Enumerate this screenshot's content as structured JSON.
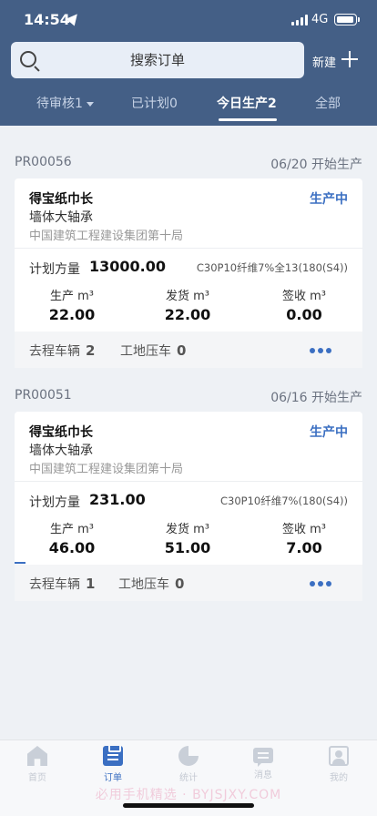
{
  "status_bar": {
    "time": "14:54",
    "network": "4G"
  },
  "search": {
    "placeholder": "搜索订单"
  },
  "header": {
    "new_label": "新建"
  },
  "tabs": [
    {
      "label": "待审核1",
      "active": false,
      "has_dropdown": true
    },
    {
      "label": "已计划0",
      "active": false
    },
    {
      "label": "今日生产2",
      "active": true
    },
    {
      "label": "全部",
      "active": false
    }
  ],
  "orders": [
    {
      "id": "PR00056",
      "start_text": "06/20 开始生产",
      "name": "得宝纸巾长",
      "state": "生产中",
      "part": "墙体大轴承",
      "company": "中国建筑工程建设集团第十局",
      "plan_label": "计划方量",
      "plan_value": "13000.00",
      "spec": "C30P10纤维7%全13(180(S4))",
      "stats": [
        {
          "label": "生产 m³",
          "value": "22.00"
        },
        {
          "label": "发货 m³",
          "value": "22.00"
        },
        {
          "label": "签收 m³",
          "value": "0.00"
        }
      ],
      "footer": {
        "vehicles_label": "去程车辆",
        "vehicles": "2",
        "pressure_label": "工地压车",
        "pressure": "0"
      }
    },
    {
      "id": "PR00051",
      "start_text": "06/16 开始生产",
      "name": "得宝纸巾长",
      "state": "生产中",
      "part": "墙体大轴承",
      "company": "中国建筑工程建设集团第十局",
      "plan_label": "计划方量",
      "plan_value": "231.00",
      "spec": "C30P10纤维7%(180(S4))",
      "stats": [
        {
          "label": "生产 m³",
          "value": "46.00"
        },
        {
          "label": "发货 m³",
          "value": "51.00"
        },
        {
          "label": "签收 m³",
          "value": "7.00"
        }
      ],
      "footer": {
        "vehicles_label": "去程车辆",
        "vehicles": "1",
        "pressure_label": "工地压车",
        "pressure": "0"
      }
    }
  ],
  "tabbar": [
    {
      "label": "首页",
      "icon": "home-icon",
      "active": false
    },
    {
      "label": "订单",
      "icon": "order-icon",
      "active": true
    },
    {
      "label": "统计",
      "icon": "stats-icon",
      "active": false
    },
    {
      "label": "消息",
      "icon": "message-icon",
      "active": false
    },
    {
      "label": "我的",
      "icon": "profile-icon",
      "active": false
    }
  ],
  "watermark": "必用手机精选 · BYJSJXY.COM",
  "colors": {
    "header": "#445f86",
    "accent": "#3b6fc2",
    "page_bg": "#eef1f5"
  }
}
